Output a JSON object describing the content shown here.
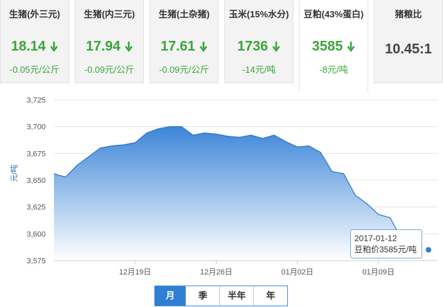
{
  "cards": [
    {
      "title": "生猪(外三元)",
      "price": "18.14",
      "change": "-0.05元/公斤",
      "trend": "down"
    },
    {
      "title": "生猪(内三元)",
      "price": "17.94",
      "change": "-0.09元/公斤",
      "trend": "down"
    },
    {
      "title": "生猪(土杂猪)",
      "price": "17.61",
      "change": "-0.09元/公斤",
      "trend": "down"
    },
    {
      "title": "玉米(15%水分)",
      "price": "1736",
      "change": "-14元/吨",
      "trend": "down"
    },
    {
      "title": "豆粕(43%蛋白)",
      "price": "3585",
      "change": "-8元/吨",
      "trend": "down",
      "active": true
    },
    {
      "title": "猪粮比",
      "price": "10.45:1",
      "change": "",
      "trend": "none"
    }
  ],
  "colors": {
    "down": "#3aa53a",
    "accent": "#2f7fd4",
    "area_top": "#3d85d8",
    "area_bottom": "#ffffff"
  },
  "chart_data": {
    "type": "area",
    "ylabel": "元/吨",
    "ylim": [
      3575,
      3725
    ],
    "yticks": [
      3575,
      3600,
      3625,
      3650,
      3675,
      3700,
      3725
    ],
    "ytick_labels": [
      "3,575",
      "3,600",
      "3,625",
      "3,650",
      "3,675",
      "3,700",
      "3,725"
    ],
    "x": [
      "2016-12-12",
      "2016-12-13",
      "2016-12-14",
      "2016-12-15",
      "2016-12-16",
      "2016-12-17",
      "2016-12-18",
      "2016-12-19",
      "2016-12-20",
      "2016-12-21",
      "2016-12-22",
      "2016-12-23",
      "2016-12-24",
      "2016-12-25",
      "2016-12-26",
      "2016-12-27",
      "2016-12-28",
      "2016-12-29",
      "2016-12-30",
      "2016-12-31",
      "2017-01-01",
      "2017-01-02",
      "2017-01-03",
      "2017-01-04",
      "2017-01-05",
      "2017-01-06",
      "2017-01-07",
      "2017-01-08",
      "2017-01-09",
      "2017-01-10",
      "2017-01-11",
      "2017-01-12"
    ],
    "values": [
      3656,
      3653,
      3664,
      3672,
      3680,
      3682,
      3683,
      3685,
      3694,
      3698,
      3700,
      3700,
      3692,
      3694,
      3693,
      3691,
      3690,
      3692,
      3689,
      3692,
      3686,
      3681,
      3682,
      3676,
      3658,
      3656,
      3636,
      3628,
      3618,
      3615,
      3595,
      3585
    ],
    "xtick_labels": [
      {
        "date": "2016-12-19",
        "label": "12月19日"
      },
      {
        "date": "2016-12-26",
        "label": "12月26日"
      },
      {
        "date": "2017-01-02",
        "label": "01月02日"
      },
      {
        "date": "2017-01-09",
        "label": "01月09日"
      }
    ],
    "tooltip": {
      "date": "2017-01-12",
      "text": "豆粕价3585元/吨"
    },
    "grid": true,
    "legend": "none"
  },
  "tabs": [
    {
      "label": "月",
      "active": true
    },
    {
      "label": "季"
    },
    {
      "label": "半年"
    },
    {
      "label": "年"
    }
  ]
}
